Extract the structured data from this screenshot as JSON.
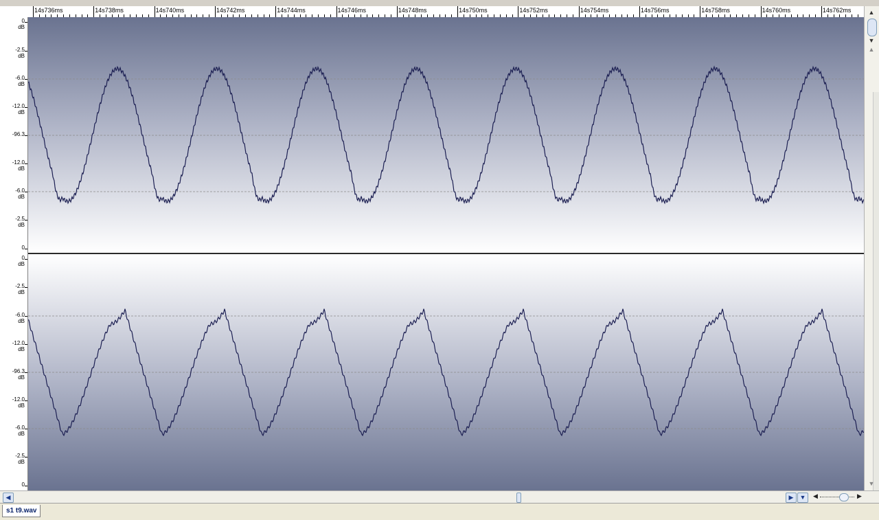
{
  "time_ruler": {
    "labels": [
      "14s736ms",
      "14s738ms",
      "14s740ms",
      "14s742ms",
      "14s744ms",
      "14s746ms",
      "14s748ms",
      "14s750ms",
      "14s752ms",
      "14s754ms",
      "14s756ms",
      "14s758ms",
      "14s760ms",
      "14s762ms"
    ]
  },
  "db_ruler": {
    "top_channel": [
      {
        "value": "0",
        "unit": "dB"
      },
      {
        "value": "-2.5",
        "unit": "dB"
      },
      {
        "value": "-6.0",
        "unit": "dB"
      },
      {
        "value": "-12.0",
        "unit": "dB"
      },
      {
        "value": "-96.3",
        "unit": ""
      },
      {
        "value": "-12.0",
        "unit": "dB"
      },
      {
        "value": "-6.0",
        "unit": "dB"
      },
      {
        "value": "-2.5",
        "unit": "dB"
      },
      {
        "value": "0",
        "unit": ""
      }
    ],
    "bottom_channel": [
      {
        "value": "0",
        "unit": "dB"
      },
      {
        "value": "-2.5",
        "unit": "dB"
      },
      {
        "value": "-6.0",
        "unit": "dB"
      },
      {
        "value": "-12.0",
        "unit": "dB"
      },
      {
        "value": "-96.3",
        "unit": "dB"
      },
      {
        "value": "-12.0",
        "unit": "dB"
      },
      {
        "value": "-6.0",
        "unit": "dB"
      },
      {
        "value": "-2.5",
        "unit": "dB"
      },
      {
        "value": "0",
        "unit": ""
      }
    ]
  },
  "waveform": {
    "channels": 2,
    "cycles_visible": 8.4,
    "line_color": "#1c1f52",
    "background_dark": "#6c7592",
    "background_light": "#ffffff",
    "guide_color": "#8a8a8a"
  },
  "scrollbars": {
    "left_arrow_icon": "arrow-left-icon",
    "right_arrow_icon": "arrow-right-icon",
    "down_arrow_icon": "arrow-down-icon",
    "up_arrow_icon": "arrow-up-icon"
  },
  "tabs": [
    {
      "label": "s1 t9.wav",
      "active": true
    }
  ]
}
